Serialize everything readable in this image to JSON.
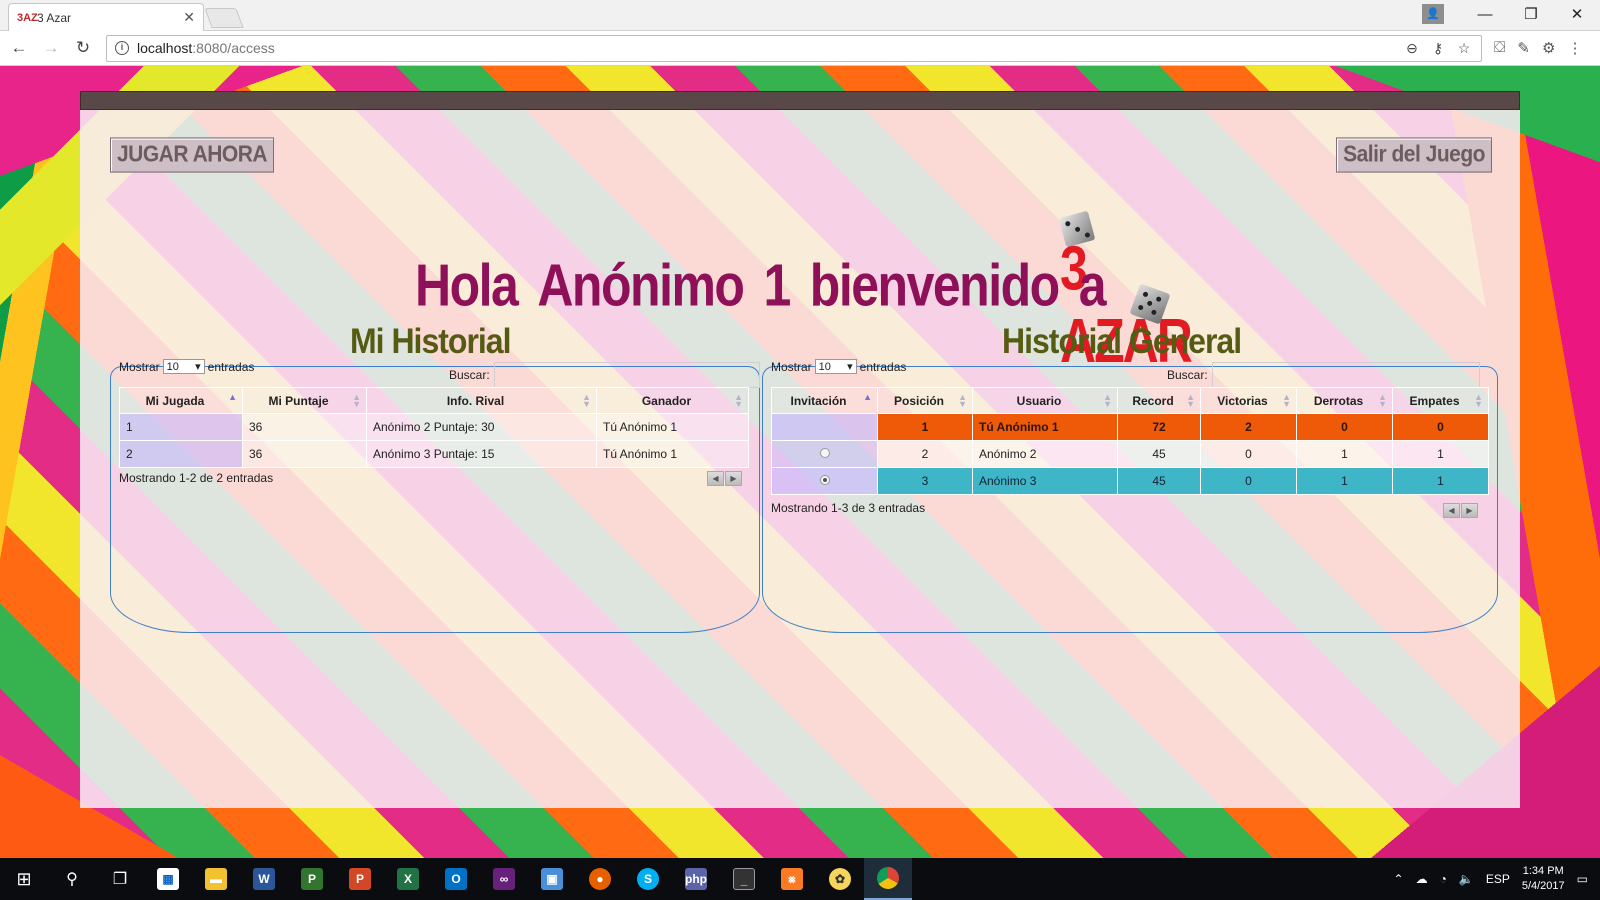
{
  "browser": {
    "tab_title": "3 Azar",
    "tab_favicon": "3AZ",
    "url_host": "localhost",
    "url_rest": ":8080/access"
  },
  "header": {
    "play_button": "JUGAR AHORA",
    "exit_button": "Salir del Juego",
    "logo_text": "3 AZAR",
    "welcome": [
      "Hola",
      "Anónimo",
      "1",
      "bienvenido",
      "a"
    ]
  },
  "my_history": {
    "title": "Mi Historial",
    "show_label": "Mostrar",
    "page_size": "10",
    "entries_label": "entradas",
    "search_label": "Buscar:",
    "columns": [
      "Mi Jugada",
      "Mi Puntaje",
      "Info. Rival",
      "Ganador"
    ],
    "rows": [
      [
        "1",
        "36",
        "Anónimo 2 Puntaje:  30",
        "Tú Anónimo 1"
      ],
      [
        "2",
        "36",
        "Anónimo 3 Puntaje:  15",
        "Tú Anónimo 1"
      ]
    ],
    "footer": "Mostrando 1-2 de 2 entradas"
  },
  "general_history": {
    "title": "Historial General",
    "show_label": "Mostrar",
    "page_size": "10",
    "entries_label": "entradas",
    "search_label": "Buscar:",
    "columns": [
      "Invitación",
      "Posición",
      "Usuario",
      "Record",
      "Victorias",
      "Derrotas",
      "Empates"
    ],
    "rows": [
      {
        "invite": "none",
        "cells": [
          "1",
          "Tú Anónimo 1",
          "72",
          "2",
          "0",
          "0"
        ]
      },
      {
        "invite": "radio",
        "cells": [
          "2",
          "Anónimo 2",
          "45",
          "0",
          "1",
          "1"
        ]
      },
      {
        "invite": "radio-selected",
        "cells": [
          "3",
          "Anónimo 3",
          "45",
          "0",
          "1",
          "1"
        ]
      }
    ],
    "footer": "Mostrando 1-3 de 3 entradas"
  },
  "colors": {
    "highlight_self": "#ee5a08",
    "highlight_selected": "#3eb6c7",
    "welcome_text": "#8e1058",
    "section_title": "#555b12"
  },
  "taskbar": {
    "time": "1:34 PM",
    "date": "5/4/2017",
    "lang": "ESP"
  }
}
